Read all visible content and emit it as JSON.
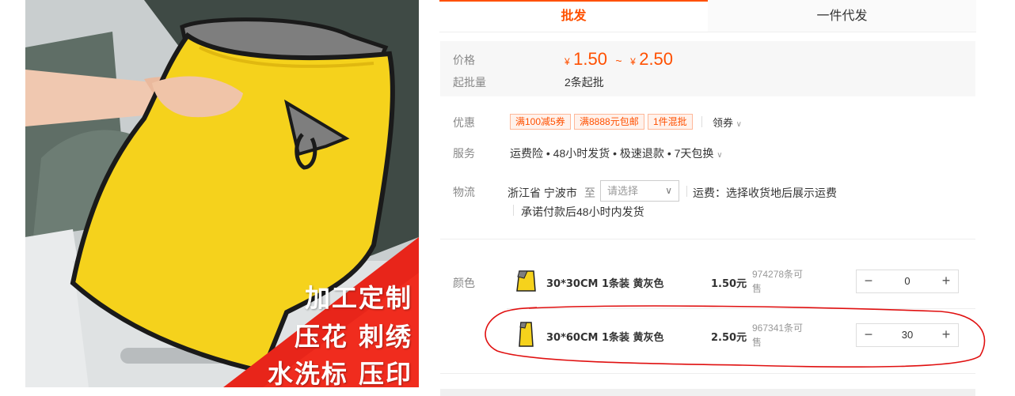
{
  "tabs": [
    {
      "label": "批发"
    },
    {
      "label": "一件代发"
    }
  ],
  "price": {
    "label": "价格",
    "currency": "¥",
    "min": "1.50",
    "separator": "~",
    "max": "2.50",
    "moq_label": "起批量",
    "moq_value": "2条起批"
  },
  "offers": {
    "label": "优惠",
    "coupons": [
      "满100减5券",
      "满8888元包邮",
      "1件混批"
    ],
    "get_coupon": "领券"
  },
  "service": {
    "label": "服务",
    "text": "运费险 • 48小时发货 • 极速退款 • 7天包换"
  },
  "logistics": {
    "label": "物流",
    "origin": "浙江省 宁波市",
    "to": "至",
    "select_placeholder": "请选择",
    "freight": "运费：选择收货地后展示运费",
    "promise": "承诺付款后48小时内发货"
  },
  "sku": {
    "label": "颜色",
    "items": [
      {
        "name": "30*30CM 1条装 黄灰色",
        "price": "1.50元",
        "stock": "974278条可售",
        "qty": "0"
      },
      {
        "name": "30*60CM 1条装 黄灰色",
        "price": "2.50元",
        "stock": "967341条可售",
        "qty": "30"
      }
    ]
  },
  "image": {
    "promo_lines": [
      "加工定制",
      "压花  刺绣",
      "水洗标  压印"
    ]
  },
  "colors": {
    "accent": "#ff5000",
    "annotation": "#e01010",
    "towel_yellow": "#f6d51e",
    "towel_gray": "#7d7d7d"
  }
}
